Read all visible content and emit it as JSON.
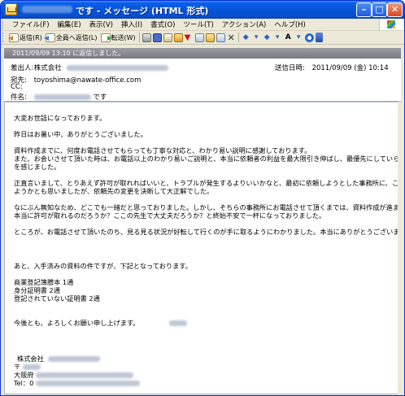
{
  "window": {
    "title": "です - メッセージ (HTML 形式)",
    "min_label": "–",
    "max_label": "□",
    "close_label": "✕"
  },
  "menu": [
    "ファイル(F)",
    "編集(E)",
    "表示(V)",
    "挿入(I)",
    "書式(O)",
    "ツール(T)",
    "アクション(A)",
    "ヘルプ(H)"
  ],
  "toolbar": {
    "reply_label": "返信(R)",
    "reply_all_label": "全員へ返信(L)",
    "forward_label": "転送(W)"
  },
  "infobar": {
    "text": "2011/09/09 13:10 に返信しました。"
  },
  "headers": {
    "from_label": "差出人:",
    "from_value": "株式会社",
    "sent_label": "送信日時:",
    "sent_value": "2011/09/09 (金) 10:14",
    "to_label": "宛先:",
    "to_value": "toyoshima@nawate-office.com",
    "cc_label": "CC:",
    "subject_label": "件名:",
    "subject_value": "です"
  },
  "body": {
    "p1": "大変お世話になっております。",
    "p2": "昨日はお暑い中、ありがとうございました。",
    "p3_l1": "資料作成までに、何度お電話させてもらっても丁寧な対応と、わかり易い説明に感謝しております。",
    "p3_l2": "また、お会いさせて頂いた時は、お電話以上のわかり易いご説明と、本当に依頼者の利益を最大限引き伸ばし、最優先にしていらっしゃるの",
    "p3_l3": "を感じました。",
    "p4_l1": "正直言いまして、とりあえず許可が取れればいいと、トラブルが発生するよりいいかなと、最初に依頼しようとした事務所に、このまま依頼し",
    "p4_l2": "ようかとも思いましたが、依頼先の変更を決断して大正解でした。",
    "p5_l1": "なにぶん無知なため、どこでも一緒だと思っておりました。しかし、そちらの事務所にお電話させて頂くまでは、資料作成が進まぬストレスと、",
    "p5_l2": "本当に許可が取れるのだろうか？ここの先生で大丈夫だろうか？と終始不安で一杯になっておりました。",
    "p6": "ところが、お電話させて頂いたのち、見る見る状況が好転して行くのが手に取るようにわかりました。本当にありがとうございます。",
    "p7": "あと、入手済みの資料の件ですが、下記となっております。",
    "p8_l1": "商業登記簿謄本 1通",
    "p8_l2": "身分証明書 2通",
    "p8_l3": "登記されていない証明書 2通",
    "p9": "今後とも、よろしくお願い申し上げます。",
    "sig_company": "株式会社",
    "sig_zip": "〒",
    "sig_addr": "大阪府",
    "sig_tel": "Tel：0"
  }
}
